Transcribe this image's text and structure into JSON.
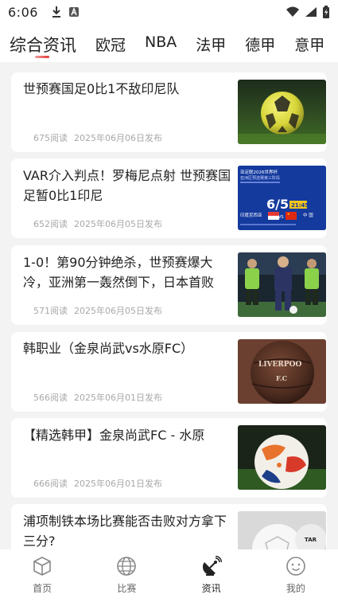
{
  "status": {
    "time": "6:06"
  },
  "tabs": [
    {
      "label": "综合资讯",
      "active": true
    },
    {
      "label": "欧冠",
      "active": false
    },
    {
      "label": "NBA",
      "active": false
    },
    {
      "label": "法甲",
      "active": false
    },
    {
      "label": "德甲",
      "active": false
    },
    {
      "label": "意甲",
      "active": false
    }
  ],
  "articles": [
    {
      "title": "世预赛国足0比1不敌印尼队",
      "reads": "675阅读",
      "date": "2025年06月06日发布",
      "image": "soccer-ball-on-grass"
    },
    {
      "title": "VAR介入判点！罗梅尼点射 世预赛国足暂0比1印尼",
      "reads": "652阅读",
      "date": "2025年06月05日发布",
      "image": "match-poster",
      "poster": {
        "l1": "亚足联2026世界杯",
        "l2": "亚洲区预选赛第三阶段",
        "date": "6/5",
        "time": "21:45",
        "team1": "印度尼西亚",
        "team2": "中 国"
      }
    },
    {
      "title": "1-0！第90分钟绝杀，世预赛爆大冷，亚洲第一轰然倒下，日本首败",
      "reads": "571阅读",
      "date": "2025年06月05日发布",
      "image": "players-match"
    },
    {
      "title": "韩职业（金泉尚武vs水原FC）",
      "reads": "566阅读",
      "date": "2025年06月01日发布",
      "image": "vintage-leather-ball",
      "ball_text": {
        "top": "LIVERPOO",
        "bottom": "F.C"
      }
    },
    {
      "title": "【精选韩甲】金泉尚武FC - 水原",
      "reads": "666阅读",
      "date": "2025年06月01日发布",
      "image": "orange-soccer-ball"
    },
    {
      "title": "浦项制铁本场比赛能否击败对方拿下三分?",
      "reads": "",
      "date": "",
      "image": "white-soccer-ball"
    }
  ],
  "nav": [
    {
      "label": "首页",
      "icon": "cube-icon",
      "active": false
    },
    {
      "label": "比赛",
      "icon": "globe-icon",
      "active": false
    },
    {
      "label": "资讯",
      "icon": "satellite-dish-icon",
      "active": true
    },
    {
      "label": "我的",
      "icon": "smiley-icon",
      "active": false
    }
  ],
  "colors": {
    "accent": "#e53935",
    "background": "#f3f3f3",
    "meta": "#a8a8a8"
  }
}
